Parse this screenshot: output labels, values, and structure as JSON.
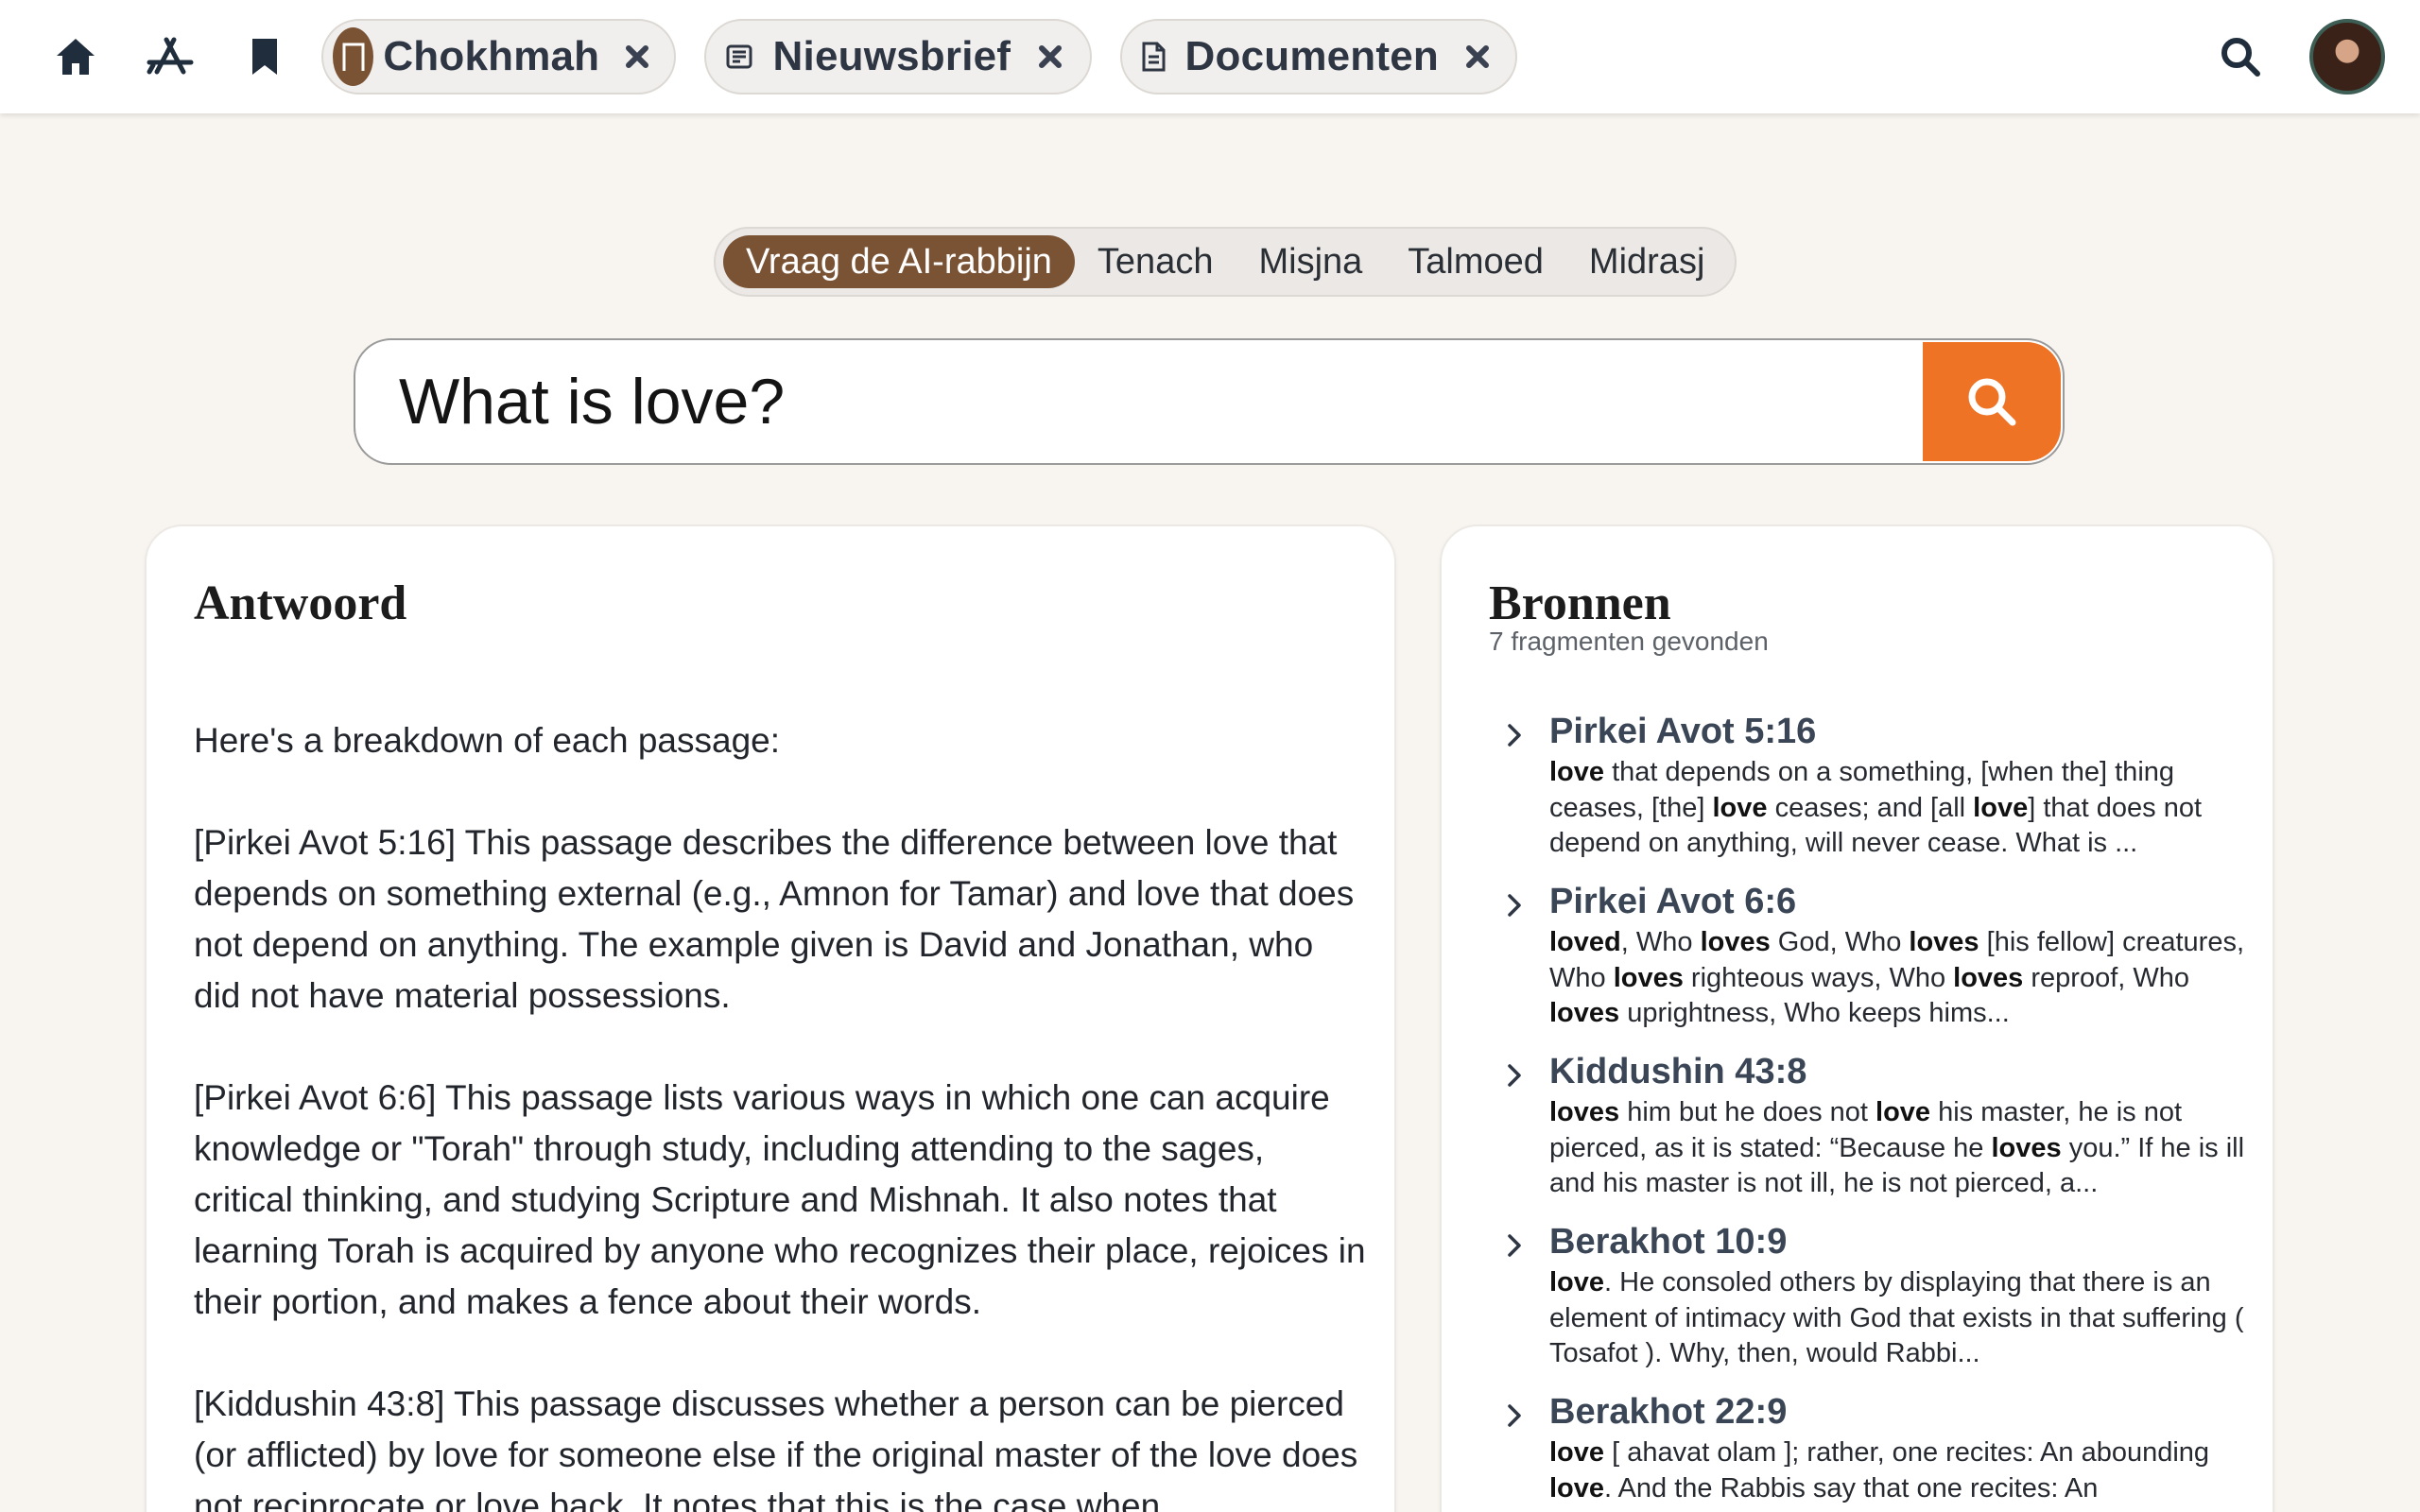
{
  "topbar": {
    "nav": [
      {
        "name": "home-icon"
      },
      {
        "name": "app-store-icon"
      },
      {
        "name": "bookmark-icon"
      }
    ],
    "tabs": [
      {
        "label": "Chokhmah",
        "icon": "chokhmah-logo"
      },
      {
        "label": "Nieuwsbrief",
        "icon": "newspaper-icon"
      },
      {
        "label": "Documenten",
        "icon": "document-icon"
      }
    ]
  },
  "segments": [
    {
      "label": "Vraag de AI-rabbijn",
      "active": true
    },
    {
      "label": "Tenach",
      "active": false
    },
    {
      "label": "Misjna",
      "active": false
    },
    {
      "label": "Talmoed",
      "active": false
    },
    {
      "label": "Midrasj",
      "active": false
    }
  ],
  "search": {
    "value": "What is love?"
  },
  "answer": {
    "title": "Antwoord",
    "paragraphs": [
      "Here's a breakdown of each passage:",
      "[Pirkei Avot 5:16] This passage describes the difference between love that depends on something external (e.g., Amnon for Tamar) and love that does not depend on anything. The example given is David and Jonathan, who did not have material possessions.",
      "[Pirkei Avot 6:6] This passage lists various ways in which one can acquire knowledge or \"Torah\" through study, including attending to the sages, critical thinking, and studying Scripture and Mishnah. It also notes that learning Torah is acquired by anyone who recognizes their place, rejoices in their portion, and makes a fence about their words.",
      "[Kiddushin 43:8] This passage discusses whether a person can be pierced (or afflicted) by love for someone else if the original master of the love does not reciprocate or love back. It notes that this is the case when"
    ]
  },
  "sources": {
    "title": "Bronnen",
    "count": "7 fragmenten gevonden",
    "items": [
      {
        "title": "Pirkei Avot 5:16",
        "snippet": [
          {
            "t": "love",
            "b": true
          },
          {
            "t": " that depends on a something, [when the] thing ceases, [the] "
          },
          {
            "t": "love",
            "b": true
          },
          {
            "t": " ceases; and [all "
          },
          {
            "t": "love",
            "b": true
          },
          {
            "t": "] that does not depend on anything, will never cease. What is ..."
          }
        ]
      },
      {
        "title": "Pirkei Avot 6:6",
        "snippet": [
          {
            "t": "loved",
            "b": true
          },
          {
            "t": ", Who "
          },
          {
            "t": "loves",
            "b": true
          },
          {
            "t": " God, Who "
          },
          {
            "t": "loves",
            "b": true
          },
          {
            "t": " [his fellow] creatures, Who "
          },
          {
            "t": "loves",
            "b": true
          },
          {
            "t": " righteous ways, Who "
          },
          {
            "t": "loves",
            "b": true
          },
          {
            "t": " reproof, Who "
          },
          {
            "t": "loves",
            "b": true
          },
          {
            "t": " uprightness, Who keeps hims..."
          }
        ]
      },
      {
        "title": "Kiddushin 43:8",
        "snippet": [
          {
            "t": "loves",
            "b": true
          },
          {
            "t": " him but he does not "
          },
          {
            "t": "love",
            "b": true
          },
          {
            "t": " his master, he is not pierced, as it is stated: “Because he "
          },
          {
            "t": "loves",
            "b": true
          },
          {
            "t": " you.” If he is ill and his master is not ill, he is not pierced, a..."
          }
        ]
      },
      {
        "title": "Berakhot 10:9",
        "snippet": [
          {
            "t": "love",
            "b": true
          },
          {
            "t": ". He consoled others by displaying that there is an element of intimacy with God that exists in that suffering ( Tosafot ). Why, then, would Rabbi..."
          }
        ]
      },
      {
        "title": "Berakhot 22:9",
        "snippet": [
          {
            "t": "love",
            "b": true
          },
          {
            "t": " [ ahavat olam ]; rather, one recites: An abounding "
          },
          {
            "t": "love",
            "b": true
          },
          {
            "t": ". And the Rabbis say that one recites: An"
          }
        ]
      }
    ]
  },
  "colors": {
    "brand": "#7a5335",
    "accent": "#ee7324",
    "background": "#f8f5f1"
  }
}
